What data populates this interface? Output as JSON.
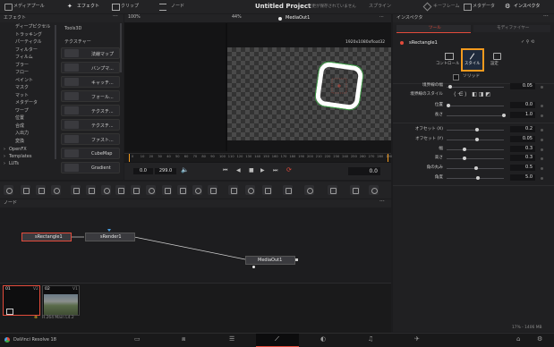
{
  "topbar": {
    "media_pool": "メディアプール",
    "effects": "エフェクト",
    "clips": "クリップ",
    "nodes": "ノード",
    "project_title": "Untitled Project",
    "unsaved_note": "変更が保存されていません",
    "spline": "スプライン",
    "keyframes": "キーフレーム",
    "metadata": "メタデータ",
    "inspector": "インスペクタ"
  },
  "effects_panel": {
    "title": "エフェクト",
    "tree": [
      "ディープピクセル",
      "トラッキング",
      "パーティクル",
      "フィルター",
      "フィルム",
      "ブラー",
      "フロー",
      "ペイント",
      "マスク",
      "マット",
      "メタデータ",
      "ワープ",
      "位置",
      "合成",
      "入出力",
      "変換"
    ],
    "openfx": "OpenFX",
    "templates": "Templates",
    "luts": "LUTs",
    "section_tools3d": "Tools3D",
    "section_texture": "テクスチャー",
    "items": [
      "法線マップ",
      "バンプマ...",
      "キャッチ...",
      "フォール...",
      "テクスチ...",
      "テクスチ...",
      "ファスト...",
      "CubeMap",
      "Gradient"
    ]
  },
  "viewer": {
    "zoom_left": "100%",
    "zoom_right": "44%",
    "output_name": "MediaOut1",
    "resolution": "1920x1080xfloat32",
    "ruler": [
      "0",
      "10",
      "20",
      "30",
      "40",
      "50",
      "60",
      "70",
      "80",
      "90",
      "100",
      "110",
      "120",
      "130",
      "140",
      "150",
      "160",
      "170",
      "180",
      "190",
      "200",
      "210",
      "220",
      "230",
      "240",
      "250",
      "260",
      "270",
      "280",
      "290"
    ],
    "time_start": "0.0",
    "time_end": "299.0",
    "current_time": "0.0"
  },
  "node_editor": {
    "title": "ノード",
    "nodes": [
      "sRectangle1",
      "sRender1",
      "MediaOut1"
    ]
  },
  "clips": [
    {
      "index": "01",
      "track": "V2",
      "codec": ""
    },
    {
      "index": "02",
      "track": "V1",
      "codec": "H.264 Main L4.2"
    }
  ],
  "inspector": {
    "title": "インスペクタ",
    "tab_tools": "ツール",
    "tab_modifiers": "モディファイヤー",
    "node_name": "sRectangle1",
    "subtabs": [
      "コントロール",
      "スタイル",
      "設定"
    ],
    "solid": "ソリッド",
    "params": [
      {
        "label": "境界線の幅",
        "value": "0.05"
      },
      {
        "label": "境界線のスタイル",
        "value": ""
      },
      {
        "label": "位置",
        "value": "0.0"
      },
      {
        "label": "長さ",
        "value": "1.0"
      },
      {
        "label": "オフセット (X)",
        "value": "0.2"
      },
      {
        "label": "オフセット (Y)",
        "value": "0.05"
      },
      {
        "label": "幅",
        "value": "0.3"
      },
      {
        "label": "高さ",
        "value": "0.3"
      },
      {
        "label": "角の丸み",
        "value": "0.5"
      },
      {
        "label": "角度",
        "value": "5.0"
      }
    ],
    "memory": "17% - 1406 MB"
  },
  "bottom": {
    "app_name": "DaVinci Resolve 18"
  },
  "colors": {
    "accent_orange": "#f39a1e",
    "selected_red": "#e34b3b",
    "node_green": "#3aa844"
  }
}
